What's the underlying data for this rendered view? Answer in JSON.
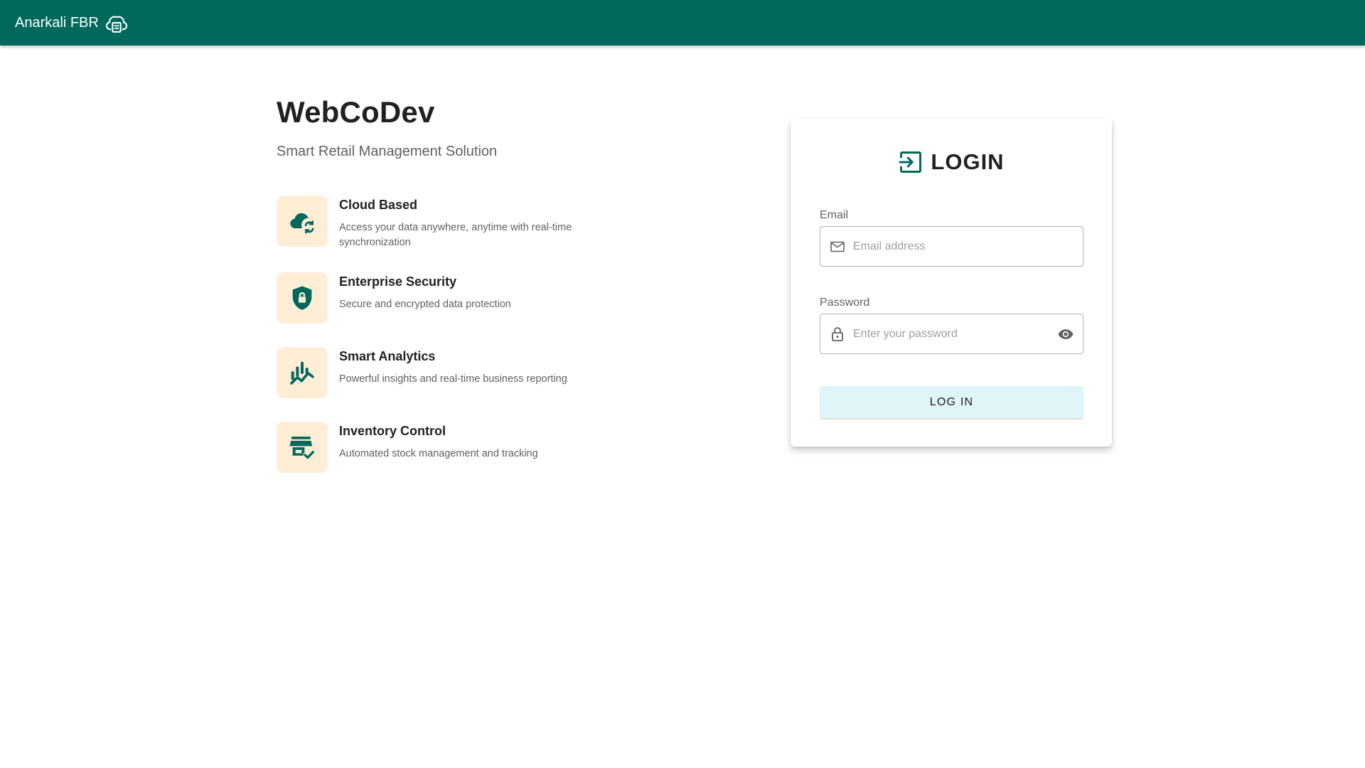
{
  "appbar": {
    "brand": "Anarkali FBR",
    "brand_icon": "printer-cloud-icon",
    "color": "#00695c"
  },
  "hero": {
    "title": "WebCoDev",
    "subtitle": "Smart Retail Management Solution"
  },
  "features": [
    {
      "icon": "cloud-sync-icon",
      "title": "Cloud Based",
      "description": "Access your data anywhere, anytime with real-time synchronization"
    },
    {
      "icon": "shield-lock-icon",
      "title": "Enterprise Security",
      "description": "Secure and encrypted data protection"
    },
    {
      "icon": "analytics-icon",
      "title": "Smart Analytics",
      "description": "Powerful insights and real-time business reporting"
    },
    {
      "icon": "store-check-icon",
      "title": "Inventory Control",
      "description": "Automated stock management and tracking"
    }
  ],
  "login": {
    "title": "LOGIN",
    "email_label": "Email",
    "email_placeholder": "Email address",
    "password_label": "Password",
    "password_placeholder": "Enter your password",
    "button": "LOG IN"
  },
  "colors": {
    "accent": "#00695c",
    "tile_bg": "#ffedd5",
    "button_bg": "#e0f5f7"
  }
}
